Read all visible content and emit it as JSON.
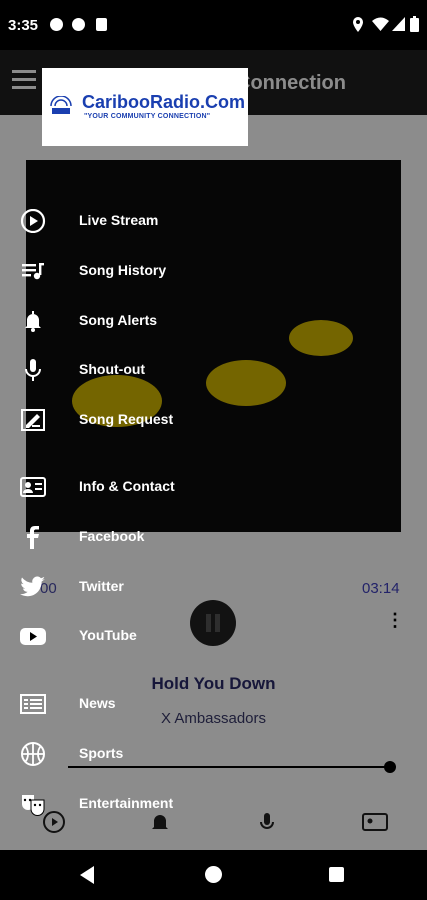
{
  "status": {
    "time": "3:35"
  },
  "app": {
    "toolbar_title": "Connection",
    "player": {
      "time_elapsed": "00",
      "time_total": "03:14",
      "song_title": "Hold You Down",
      "artist": "X Ambassadors"
    }
  },
  "drawer": {
    "logo": {
      "name": "CaribooRadio.Com",
      "tagline": "\"YOUR COMMUNITY CONNECTION\""
    },
    "items": [
      {
        "label": "Live Stream",
        "icon": "play-circle-icon"
      },
      {
        "label": "Song History",
        "icon": "playlist-icon"
      },
      {
        "label": "Song Alerts",
        "icon": "bell-icon"
      },
      {
        "label": "Shout-out",
        "icon": "microphone-icon"
      },
      {
        "label": "Song Request",
        "icon": "edit-card-icon"
      },
      {
        "label": "Info & Contact",
        "icon": "contact-card-icon"
      },
      {
        "label": "Facebook",
        "icon": "facebook-icon"
      },
      {
        "label": "Twitter",
        "icon": "twitter-icon"
      },
      {
        "label": "YouTube",
        "icon": "youtube-icon"
      },
      {
        "label": "News",
        "icon": "news-icon"
      },
      {
        "label": "Sports",
        "icon": "basketball-icon"
      },
      {
        "label": "Entertainment",
        "icon": "theater-masks-icon"
      }
    ]
  }
}
